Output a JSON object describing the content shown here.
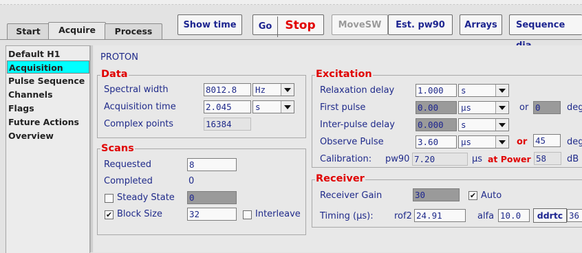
{
  "tabs": [
    "Start",
    "Acquire",
    "Process"
  ],
  "toolbar": {
    "show_time": "Show time",
    "go": "Go",
    "stop": "Stop",
    "movesw": "MoveSW",
    "est_pw90": "Est. pw90",
    "arrays": "Arrays",
    "sequence_diag": "Sequence dia"
  },
  "sidebar": {
    "items": [
      "Default H1",
      "Acquisition",
      "Pulse Sequence",
      "Channels",
      "Flags",
      "Future Actions",
      "Overview"
    ],
    "selected": "Acquisition"
  },
  "nucleus": "PROTON",
  "data_group": {
    "title": "Data",
    "spectral_width": {
      "label": "Spectral width",
      "value": "8012.8",
      "unit": "Hz"
    },
    "acquisition_time": {
      "label": "Acquisition time",
      "value": "2.045",
      "unit": "s"
    },
    "complex_points": {
      "label": "Complex points",
      "value": "16384"
    }
  },
  "scans_group": {
    "title": "Scans",
    "requested": {
      "label": "Requested",
      "value": "8"
    },
    "completed": {
      "label": "Completed",
      "value": "0"
    },
    "steady_state": {
      "label": "Steady State",
      "value": "0",
      "checked": false
    },
    "block_size": {
      "label": "Block Size",
      "value": "32",
      "checked": true
    },
    "interleave": {
      "label": "Interleave",
      "checked": false
    }
  },
  "excitation_group": {
    "title": "Excitation",
    "relaxation_delay": {
      "label": "Relaxation delay",
      "value": "1.000",
      "unit": "s"
    },
    "first_pulse": {
      "label": "First pulse",
      "value": "0.00",
      "unit": "µs",
      "or": "or",
      "deg_value": "0",
      "deg": "deg"
    },
    "inter_pulse_delay": {
      "label": "Inter-pulse delay",
      "value": "0.000",
      "unit": "s"
    },
    "observe_pulse": {
      "label": "Observe Pulse",
      "value": "3.60",
      "unit": "µs",
      "or": "or",
      "deg_value": "45",
      "deg": "deg"
    },
    "calibration": {
      "label": "Calibration:",
      "param": "pw90",
      "value": "7.20",
      "unit": "µs",
      "at_power": "at Power",
      "power_value": "58",
      "power_unit": "dB"
    }
  },
  "receiver_group": {
    "title": "Receiver",
    "receiver_gain": {
      "label": "Receiver Gain",
      "value": "30",
      "auto_label": "Auto",
      "auto_checked": true
    },
    "timing": {
      "label": "Timing (µs):",
      "rof2_label": "rof2",
      "rof2_value": "24.91",
      "alfa_label": "alfa",
      "alfa_value": "10.0",
      "ddrtc_label": "ddrtc",
      "ddrtc_value": "36"
    }
  }
}
